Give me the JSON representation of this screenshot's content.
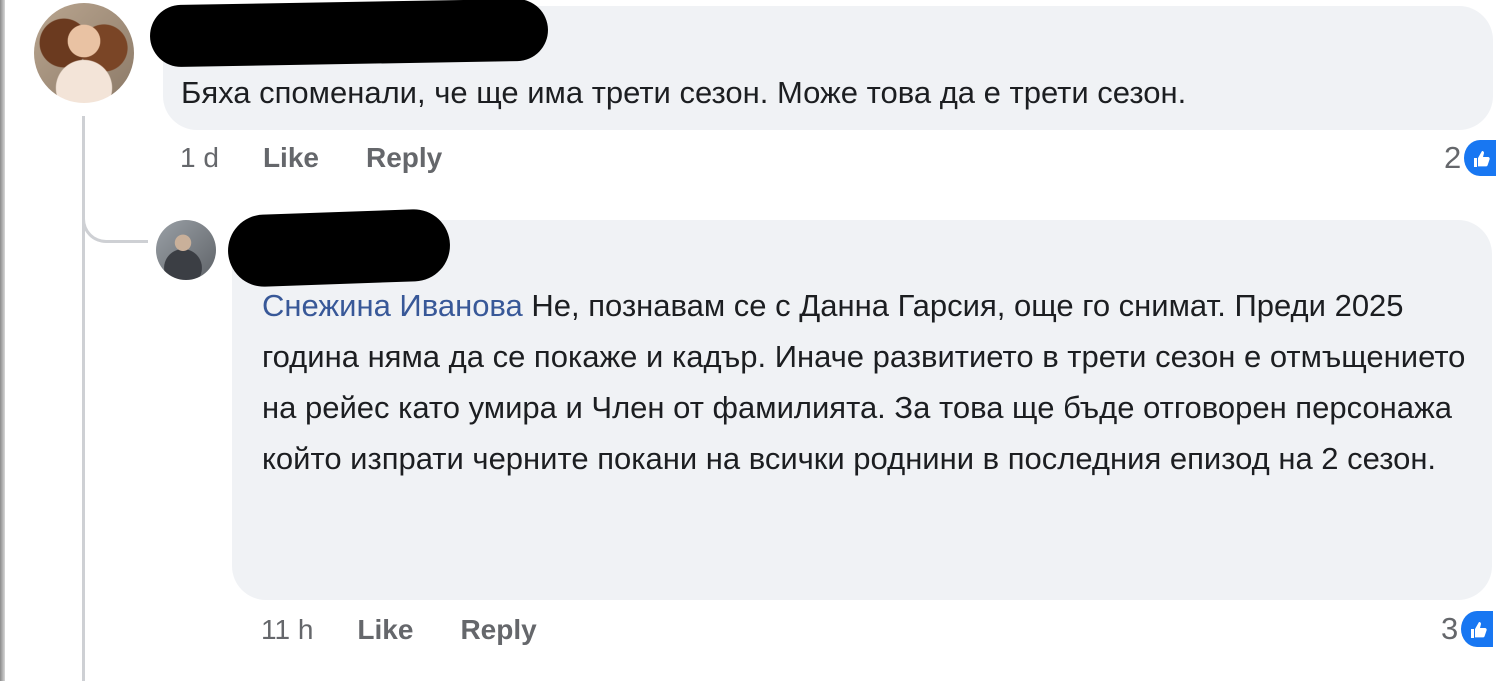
{
  "comments": [
    {
      "author": "",
      "text": "Бяха споменали, че ще има трети сезон. Може това да е трети сезон.",
      "time": "1 d",
      "like_label": "Like",
      "reply_label": "Reply",
      "reaction_count": "2"
    },
    {
      "author": "",
      "mention": "Снежина Иванова",
      "text": " Не, познавам се с Данна Гарсия, още го снимат. Преди 2025 година няма да се покаже и кадър.  Иначе развитието в трети сезон е отмъщението на рейес като умира и Член от фамилията. За това ще бъде отговорен персонажа който изпрати черните покани на всички роднини в последния епизод на 2 сезон.",
      "time": "11 h",
      "like_label": "Like",
      "reply_label": "Reply",
      "reaction_count": "3"
    }
  ],
  "colors": {
    "bubble": "#f0f2f5",
    "text": "#1c1e21",
    "secondary": "#65676b",
    "mention": "#385898",
    "like_blue": "#1877f2"
  },
  "icons": {
    "reaction": "like-thumb-icon"
  }
}
